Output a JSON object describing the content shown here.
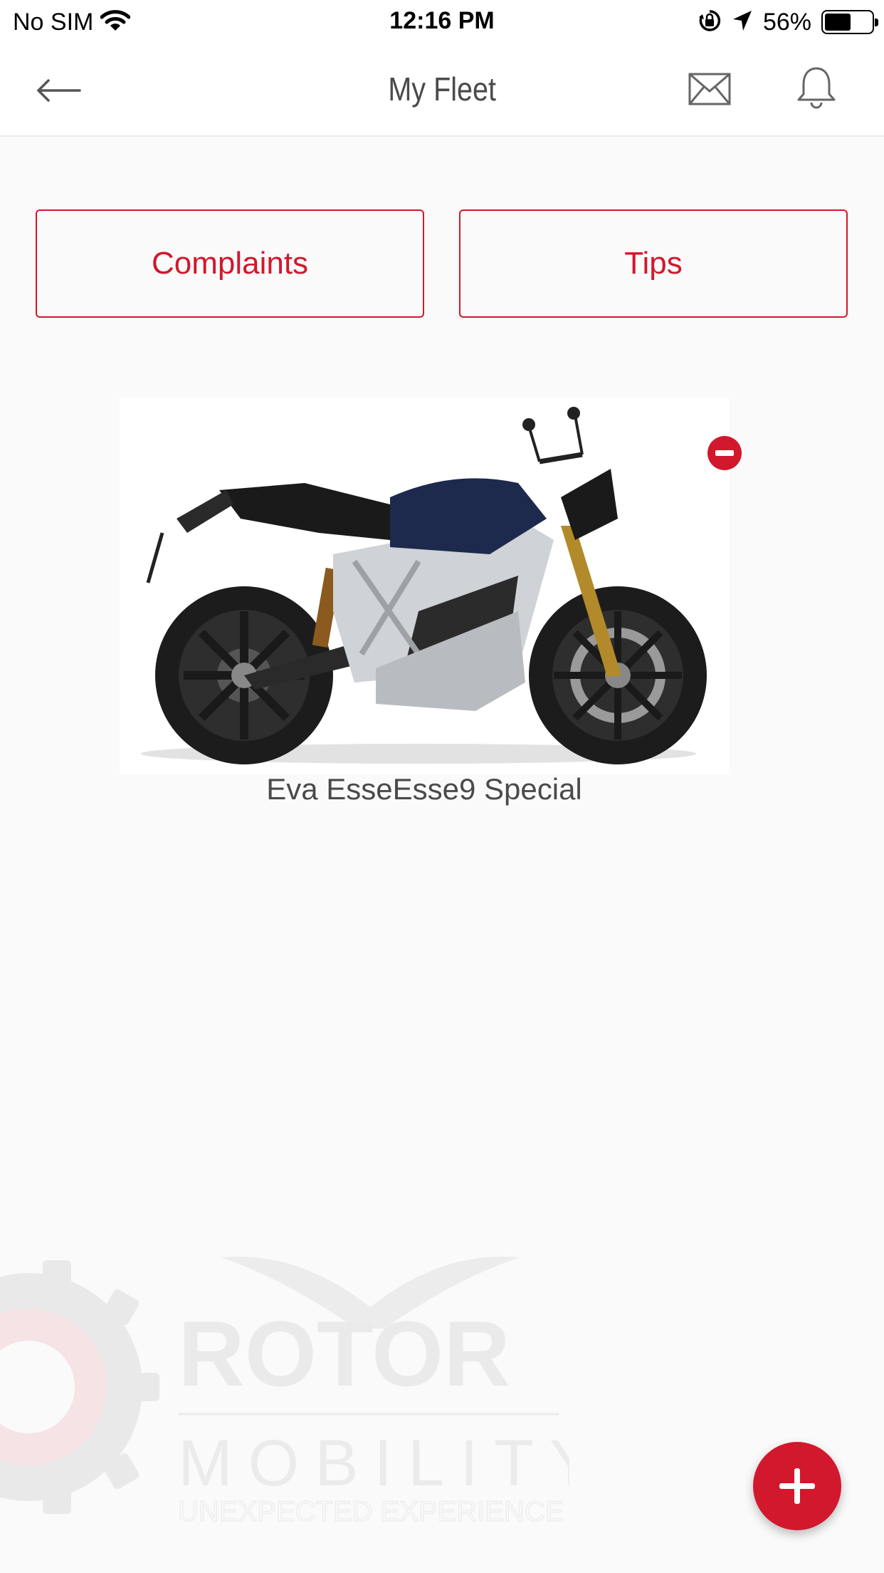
{
  "status_bar": {
    "carrier": "No SIM",
    "time": "12:16 PM",
    "battery_percent": "56%",
    "battery_level": 0.56,
    "icons": [
      "wifi-icon",
      "orientation-lock-icon",
      "location-arrow-icon",
      "battery-icon"
    ]
  },
  "nav": {
    "title": "My Fleet",
    "back_icon": "back-arrow-icon",
    "mail_icon": "mail-icon",
    "bell_icon": "bell-icon"
  },
  "actions": {
    "complaints_label": "Complaints",
    "tips_label": "Tips"
  },
  "fleet": {
    "vehicles": [
      {
        "name": "Eva EsseEsse9 Special",
        "image_icon": "motorcycle-image",
        "remove_icon": "remove-icon"
      }
    ]
  },
  "watermark": {
    "brand_name": "ROTOR",
    "brand_line2": "MOBILITY",
    "tagline": "UNEXPECTED EXPERIENCE"
  },
  "fab": {
    "icon": "plus-icon"
  },
  "colors": {
    "accent": "#d2182c",
    "background": "#fafafa",
    "title_text": "#4a4a4a"
  }
}
